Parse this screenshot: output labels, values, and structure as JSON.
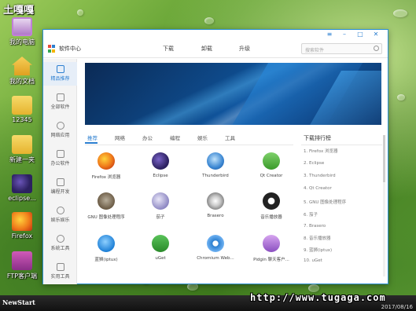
{
  "watermark_top": "土嘎嘎",
  "desktop_icons": [
    {
      "label": "我的电脑",
      "icon": "computer-icon"
    },
    {
      "label": "我的文档",
      "icon": "home-folder-icon"
    },
    {
      "label": "12345",
      "icon": "folder-icon"
    },
    {
      "label": "新建一夹",
      "icon": "folder-icon"
    },
    {
      "label": "eclipse...",
      "icon": "eclipse-icon"
    },
    {
      "label": "Firefox",
      "icon": "firefox-icon"
    },
    {
      "label": "FTP客户端",
      "icon": "ftp-icon"
    }
  ],
  "window": {
    "controls": [
      "≡",
      "–",
      "□",
      "✕"
    ],
    "app_title": "软件中心",
    "top_nav": [
      "下载",
      "卸载",
      "升级"
    ],
    "search_placeholder": "搜索软件"
  },
  "sidebar": [
    {
      "label": "精品推荐",
      "icon": "star-icon",
      "active": true
    },
    {
      "label": "全部软件",
      "icon": "grid-icon",
      "active": false
    },
    {
      "label": "网络应用",
      "icon": "globe-icon",
      "active": false
    },
    {
      "label": "办公软件",
      "icon": "briefcase-icon",
      "active": false
    },
    {
      "label": "编程开发",
      "icon": "code-icon",
      "active": false
    },
    {
      "label": "娱乐娱乐",
      "icon": "gamepad-icon",
      "active": false
    },
    {
      "label": "系统工具",
      "icon": "gear-icon",
      "active": false
    },
    {
      "label": "实用工具",
      "icon": "toolbox-icon",
      "active": false
    }
  ],
  "tabs": [
    "推荐",
    "网络",
    "办公",
    "编程",
    "娱乐",
    "工具"
  ],
  "apps": [
    {
      "label": "Firefox 浏览器",
      "icon": "firefox-icon"
    },
    {
      "label": "Eclipse",
      "icon": "eclipse-icon"
    },
    {
      "label": "Thunderbird",
      "icon": "thunderbird-icon"
    },
    {
      "label": "Qt Creator",
      "icon": "qt-creator-icon"
    },
    {
      "label": "GNU 图像处理程序",
      "icon": "gimp-icon"
    },
    {
      "label": "茄子",
      "icon": "cheese-icon"
    },
    {
      "label": "Brasero",
      "icon": "brasero-icon"
    },
    {
      "label": "音乐播放器",
      "icon": "audio-player-icon"
    },
    {
      "label": "蓝狮(iptux)",
      "icon": "ie-icon"
    },
    {
      "label": "uGet",
      "icon": "uget-icon"
    },
    {
      "label": "Chromium Web...",
      "icon": "chromium-icon"
    },
    {
      "label": "Pidgin 聊天客户...",
      "icon": "pidgin-icon"
    }
  ],
  "ranking": {
    "title": "下载排行榜",
    "items": [
      "1. Firefox 浏览器",
      "2. Eclipse",
      "3. Thunderbird",
      "4. Qt Creator",
      "5. GNU 图像处理程序",
      "6. 茄子",
      "7. Brasero",
      "8. 音乐播放器",
      "9. 蓝狮(iptux)",
      "10. uGet"
    ]
  },
  "taskbar": {
    "start_label": "NewStart",
    "url_watermark": "http://www.tugaga.com",
    "date": "2017/08/16"
  },
  "colors": {
    "accent": "#2c7fd0",
    "window_border": "#2b8fd0"
  }
}
